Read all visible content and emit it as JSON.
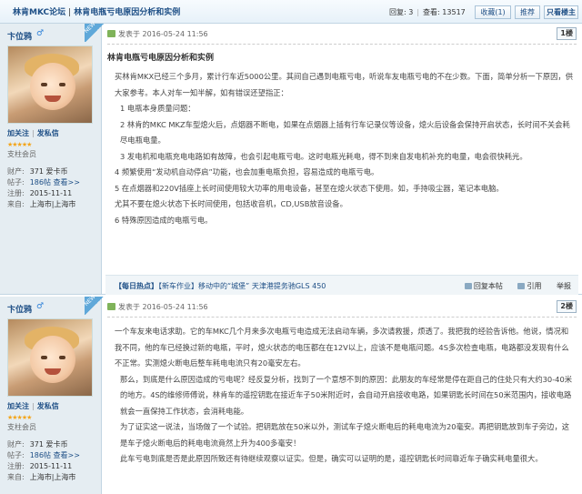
{
  "breadcrumb": {
    "forum": "林肯MKC论坛",
    "separator": "|",
    "thread_title": "林肯电瓶亏电原因分析和实例"
  },
  "stats": {
    "replies_label": "回复:",
    "replies": "3",
    "views_label": "查看:",
    "views": "13517"
  },
  "buttons": {
    "favorite": "收藏(1)",
    "recommend": "推荐",
    "only_author": "只看楼主"
  },
  "posts": [
    {
      "author": "卞位鸦",
      "gender_icon": "male-icon",
      "follow": "加关注",
      "message": "发私信",
      "stars": "★★★★★",
      "group": "支柱会员",
      "wealth_label": "财产:",
      "wealth": "371 爱卡币",
      "threads_label": "帖子:",
      "threads": "186帖",
      "threads_link": "查看>>",
      "reg_label": "注册:",
      "reg": "2015-11-11",
      "from_label": "来自:",
      "from": "上海市|上海市",
      "new_badge": "NEW",
      "posted": "发表于 2016-05-24 11:56",
      "floor": "1楼",
      "title": "林肯电瓶亏电原因分析和实例",
      "paragraphs": [
        "买林肯MKX已经三个多月，累计行车近5000公里。其间自己遇到电瓶亏电，听说车友电瓶亏电的不在少数。下面，简单分析一下原因，供大家参考。本人对车一知半解，如有错误还望指正：",
        "1 电瓶本身质量问题：",
        "2 林肯的MKC MKZ车型熄火后，点烟器不断电，如果在点烟器上插有行车记录仪等设备，熄火后设备会保持开启状态，长时间不关会耗尽电瓶电量。",
        "3 发电机和电瓶充电电路如有故障，也会引起电瓶亏电。这时电瓶光耗电，得不到来自发电机补充的电量，电会很快耗光。",
        "4 频繁使用“发动机自动停启”功能，也会加重电瓶负担，容易造成的电瓶亏电。",
        "5 在点烟器和220V插座上长时间使用较大功率的用电设备，甚至在熄火状态下使用。如，手持吸尘器，笔记本电脑。",
        "尤其不要在熄火状态下长时间使用，包括收音机，CD,USB放音设备。",
        "6 特殊原因造成的电瓶亏电。"
      ],
      "hot_label": "【每日热点】",
      "hot_text": "【新车作业】移动中的“城堡” 天津港提务驰GLS 450",
      "actions": [
        "回复本帖",
        "引用",
        "举报"
      ]
    },
    {
      "author": "卞位鸦",
      "gender_icon": "male-icon",
      "follow": "加关注",
      "message": "发私信",
      "stars": "★★★★★",
      "group": "支柱会员",
      "wealth_label": "财产:",
      "wealth": "371 爱卡币",
      "threads_label": "帖子:",
      "threads": "186帖",
      "threads_link": "查看>>",
      "reg_label": "注册:",
      "reg": "2015-11-11",
      "from_label": "来自:",
      "from": "上海市|上海市",
      "new_badge": "NEW",
      "posted": "发表于 2016-05-24 11:56",
      "floor": "2楼",
      "paragraphs": [
        "一个车友来电话求助。它的车MKC几个月来多次电瓶亏电造成无法启动车辆，多次请救援，烦透了。我把我的经验告诉他。他说，情况和我不同，他的车已经换过新的电瓶，平时，熄火状态的电压都在在12V以上，应该不是电瓶问题。4S多次检查电瓶，电路都没发现有什么不正常。实测熄火断电后整车耗电电流只有20毫安左右。",
        "那么，到底是什么原因造成的亏电呢？经反复分析，找到了一个意想不到的原因：此朋友的车经常是停在距自己的住处只有大约30-40米的地方。4S的维修师傅说，林肯车的遥控钥匙在接近车子50米附近时，会自动开启接收电路，如果钥匙长时间在50米范围内，接收电路就会一直保持工作状态，会消耗电能。",
        "为了证实这一说法，当场做了一个试验。把钥匙放在50米以外，测试车子熄火断电后的耗电电流为20毫安。再把钥匙放到车子旁边，这是车子熄火断电后的耗电电流竟然上升为400多毫安！",
        "此车亏电到底是否是此原因所致还有待继续观察以证实。但是，确实可以证明的是，遥控钥匙长时间靠近车子确实耗电量很大。"
      ]
    }
  ]
}
